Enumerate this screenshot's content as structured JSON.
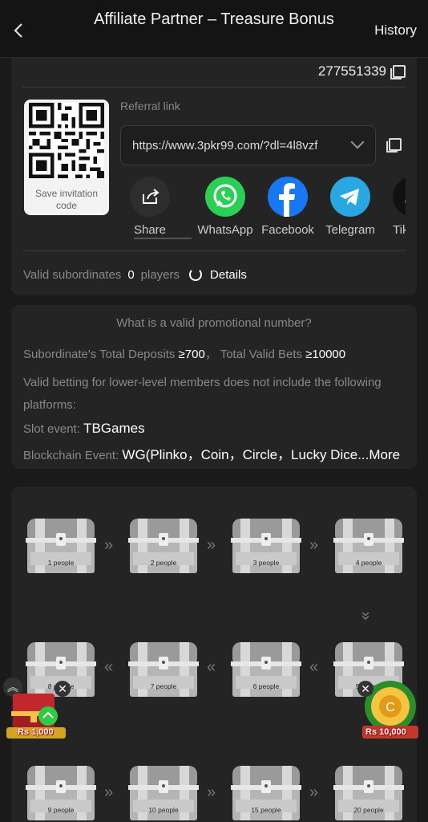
{
  "header": {
    "back_icon": "chevron-left-icon",
    "title": "Affiliate Partner – Treasure Bonus",
    "history_label": "History"
  },
  "invite": {
    "user_id": "277551339",
    "qr_label": "Save invitation code",
    "referral_label": "Referral link",
    "referral_url": "https://www.3pkr99.com/?dl=4l8vzf",
    "share_items": [
      {
        "label": "Share",
        "icon": "share-icon",
        "color": "#2e2e2e"
      },
      {
        "label": "WhatsApp",
        "icon": "whatsapp-icon",
        "color": "#2ccf55"
      },
      {
        "label": "Facebook",
        "icon": "facebook-icon",
        "color": "#1877f2"
      },
      {
        "label": "Telegram",
        "icon": "telegram-icon",
        "color": "#2aa6e0"
      },
      {
        "label": "Tikt",
        "icon": "tiktok-icon",
        "color": "#111111"
      }
    ],
    "valid_subordinates_label": "Valid subordinates",
    "valid_subordinates_count": "0",
    "players_label": "players",
    "details_label": "Details"
  },
  "rules": {
    "title": "What is a valid promotional number?",
    "deposit_label": "Subordinate's Total Deposits",
    "deposit_value": "≥700",
    "bets_label": "Total Valid Bets",
    "bets_value": "≥10000",
    "exclusion_line1": "Valid betting for lower-level members does not include the following",
    "exclusion_line2": "platforms:",
    "slot_label": "Slot event:",
    "slot_value": "TBGames",
    "blockchain_label": "Blockchain Event:",
    "blockchain_value": "WG(Plinko，Coin，Circle，Lucky Dice",
    "more_label": "...More"
  },
  "chests": [
    {
      "label": "1 people"
    },
    {
      "label": "2 people"
    },
    {
      "label": "3 people"
    },
    {
      "label": "4 people"
    },
    {
      "label": "5 people"
    },
    {
      "label": "6 people"
    },
    {
      "label": "7 people"
    },
    {
      "label": "8 people"
    },
    {
      "label": "9 people"
    },
    {
      "label": "10 people"
    },
    {
      "label": "15 people"
    },
    {
      "label": "20 people"
    }
  ],
  "floating": {
    "left_amount": "Rs 1,000",
    "right_amount": "Rs 10,000"
  },
  "colors": {
    "background": "#1a1a1a",
    "card": "#242424",
    "accent_green": "#2ccf55"
  }
}
